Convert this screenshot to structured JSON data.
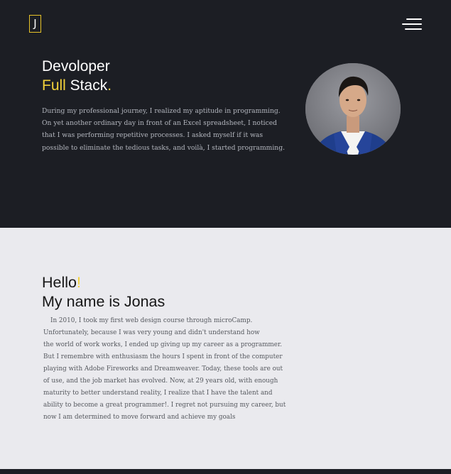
{
  "header": {
    "logo_letter": "J",
    "menu_icon": "hamburger-menu-icon"
  },
  "hero": {
    "title_line1": "Devoloper",
    "title_accent": "Full",
    "title_rest": " Stack",
    "title_dot": ".",
    "text": "During my professional journey, I realized my aptitude in programming. On yet another ordinary day in front of an Excel spreadsheet, I noticed that I was performing repetitive processes. I asked myself if it was possible to eliminate the tedious tasks, and voilà, I started programming.",
    "photo": "profile-photo"
  },
  "about": {
    "hello": "Hello",
    "hello_mark": "!",
    "name_line": "My name is Jonas",
    "lines": [
      "In 2010, I took my first web design course through microCamp.",
      "Unfortunately, because I was very young and didn't understand how",
      "the world of work works, I ended up giving up my career as a programmer.",
      "But I remembre with enthusiasm the hours I spent in front of the computer",
      "playing with Adobe Fireworks and Dreamweaver. Today, these tools are out",
      "of use, and the job market has evolved. Now, at 29 years old, with enough",
      "maturity to better understand reality, I realize that I have the talent and",
      "ability to become a great programmer!. I regret not pursuing my career, but",
      "now I am determined to move forward and achieve my goals"
    ]
  },
  "colors": {
    "dark_bg": "#1c1e24",
    "light_bg": "#eaeaee",
    "accent": "#f2d13a"
  }
}
